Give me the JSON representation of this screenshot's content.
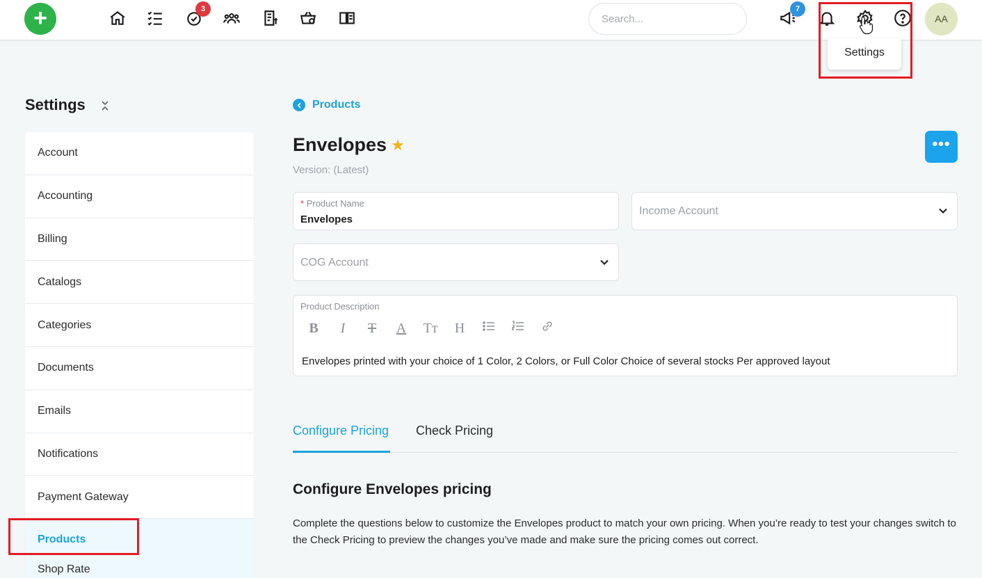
{
  "topbar": {
    "add_label": "+",
    "tasks_badge": "3",
    "announcements_badge": "7",
    "search_placeholder": "Search...",
    "avatar_initials": "AA",
    "settings_tooltip": "Settings"
  },
  "sidebar": {
    "title": "Settings",
    "items": [
      {
        "label": "Account"
      },
      {
        "label": "Accounting"
      },
      {
        "label": "Billing"
      },
      {
        "label": "Catalogs"
      },
      {
        "label": "Categories"
      },
      {
        "label": "Documents"
      },
      {
        "label": "Emails"
      },
      {
        "label": "Notifications"
      },
      {
        "label": "Payment Gateway"
      },
      {
        "label": "Products"
      },
      {
        "label": "Shop Rate"
      }
    ],
    "active_item": "Products"
  },
  "main": {
    "breadcrumb": "Products",
    "title": "Envelopes",
    "version": "Version: (Latest)",
    "more_label": "•••",
    "product_name": {
      "label": "Product Name",
      "value": "Envelopes",
      "required_mark": "*"
    },
    "income_account": {
      "placeholder": "Income Account"
    },
    "cog_account": {
      "placeholder": "COG Account"
    },
    "description": {
      "label": "Product Description",
      "text": "Envelopes printed with your choice of 1 Color, 2 Colors, or Full Color Choice of several stocks Per approved layout"
    },
    "toolbar": [
      "B",
      "I",
      "T",
      "A",
      "Tт",
      "H",
      "list",
      "ordered-list",
      "link"
    ],
    "tabs": [
      {
        "label": "Configure Pricing"
      },
      {
        "label": "Check Pricing"
      }
    ],
    "active_tab": "Configure Pricing",
    "section_title": "Configure Envelopes pricing",
    "section_body": "Complete the questions below to customize the Envelopes product to match your own pricing. When you’re ready to test your changes switch to the Check Pricing to preview the changes you’ve made and make sure the pricing comes out correct."
  },
  "colors": {
    "accent": "#1ba3dd",
    "add_button": "#2db34a",
    "highlight": "#e31b23",
    "badge_red": "#e0393e",
    "badge_blue": "#2f93dd"
  }
}
